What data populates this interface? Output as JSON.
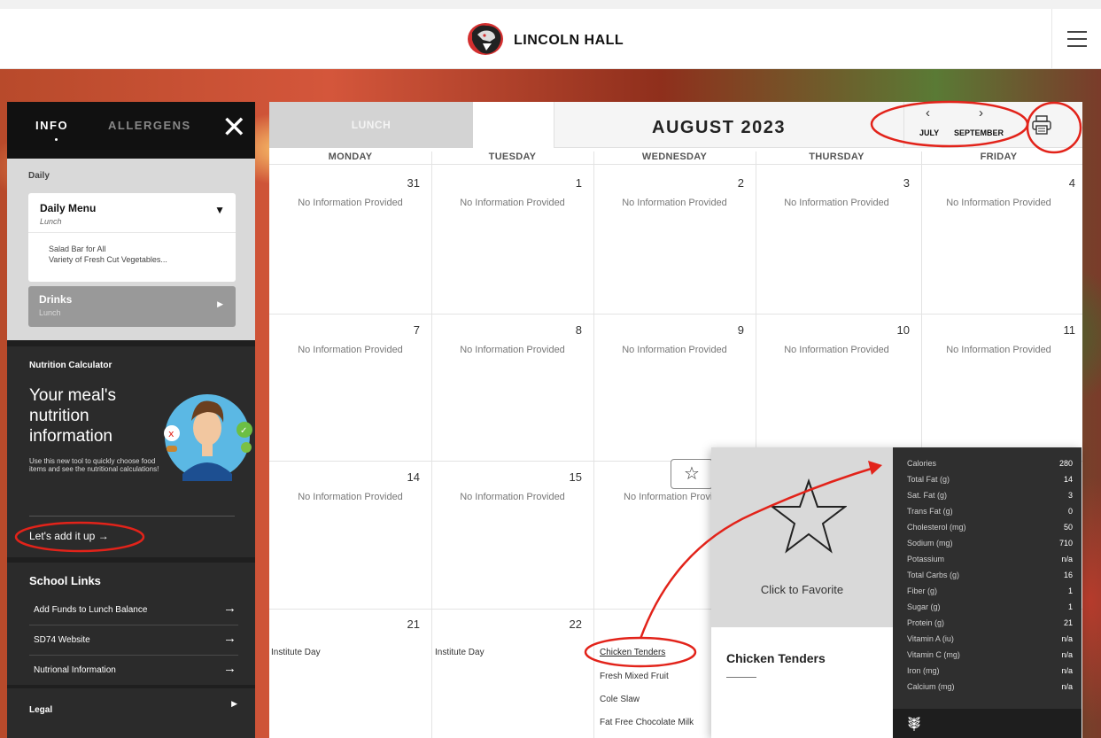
{
  "header": {
    "brand": "LINCOLN HALL"
  },
  "sidebar": {
    "tabs": {
      "info": "INFO",
      "allergens": "ALLERGENS"
    },
    "daily_title": "Daily",
    "daily_menu": {
      "title": "Daily Menu",
      "subtitle": "Lunch",
      "items": [
        "Salad Bar for All",
        "Variety of Fresh Cut Vegetables..."
      ]
    },
    "drinks": {
      "title": "Drinks",
      "subtitle": "Lunch"
    },
    "nutrition": {
      "heading": "Nutrition Calculator",
      "big_text": "Your meal's nutrition information",
      "small_text": "Use this new tool to quickly choose food items and see the nutritional calculations!",
      "cta": "Let's add it up"
    },
    "school_links": {
      "heading": "School Links",
      "items": [
        "Add Funds to Lunch Balance",
        "SD74 Website",
        "Nutrional Information"
      ]
    },
    "legal": "Legal"
  },
  "calendar": {
    "meal_tab": "LUNCH",
    "month": "AUGUST 2023",
    "prev_label": "JULY",
    "next_label": "SEPTEMBER",
    "weekdays": [
      "MONDAY",
      "TUESDAY",
      "WEDNESDAY",
      "THURSDAY",
      "FRIDAY"
    ],
    "no_info": "No Information Provided",
    "weeks": [
      [
        "31",
        "1",
        "2",
        "3",
        "4"
      ],
      [
        "7",
        "8",
        "9",
        "10",
        "11"
      ],
      [
        "14",
        "15",
        "",
        "",
        ""
      ],
      [
        "21",
        "22",
        "",
        "",
        ""
      ]
    ],
    "institute_day": "Institute Day",
    "wed_menu": [
      "Chicken Tenders",
      "Fresh Mixed Fruit",
      "Cole Slaw",
      "Fat Free Chocolate Milk"
    ]
  },
  "popup": {
    "favorite_label": "Click to Favorite",
    "item_name": "Chicken Tenders",
    "nutrition": [
      {
        "k": "Calories",
        "v": "280"
      },
      {
        "k": "Total Fat (g)",
        "v": "14"
      },
      {
        "k": "Sat. Fat (g)",
        "v": "3"
      },
      {
        "k": "Trans Fat (g)",
        "v": "0"
      },
      {
        "k": "Cholesterol (mg)",
        "v": "50"
      },
      {
        "k": "Sodium (mg)",
        "v": "710"
      },
      {
        "k": "Potassium",
        "v": "n/a"
      },
      {
        "k": "Total Carbs (g)",
        "v": "16"
      },
      {
        "k": "Fiber (g)",
        "v": "1"
      },
      {
        "k": "Sugar (g)",
        "v": "1"
      },
      {
        "k": "Protein (g)",
        "v": "21"
      },
      {
        "k": "Vitamin A (iu)",
        "v": "n/a"
      },
      {
        "k": "Vitamin C (mg)",
        "v": "n/a"
      },
      {
        "k": "Iron (mg)",
        "v": "n/a"
      },
      {
        "k": "Calcium (mg)",
        "v": "n/a"
      }
    ]
  },
  "colors": {
    "annotation": "#e2231a",
    "sidebar_dark": "#1f1f1f",
    "panel_gray": "#d9d9d9"
  }
}
